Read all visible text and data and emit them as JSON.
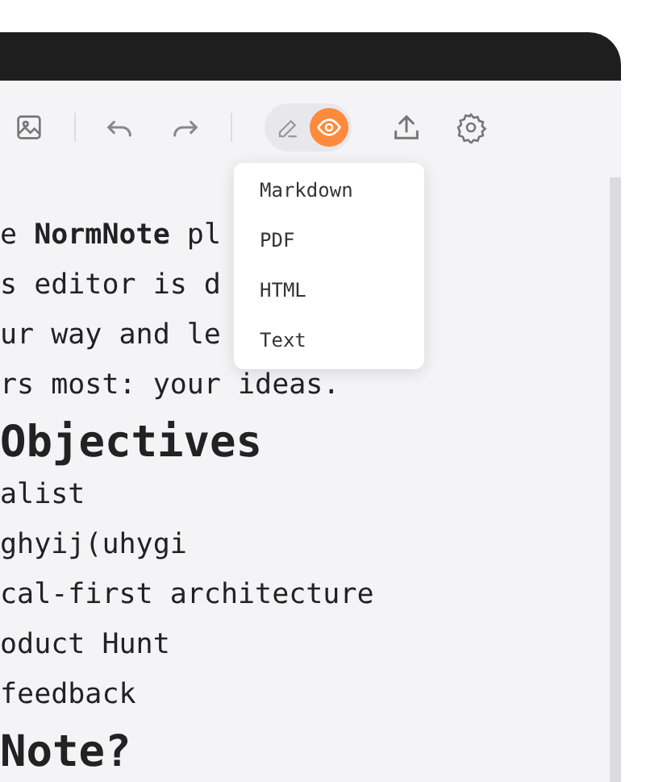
{
  "toolbar": {
    "modes": [
      {
        "kind": "edit",
        "selected": false
      },
      {
        "kind": "preview",
        "selected": true
      }
    ]
  },
  "export_menu": {
    "items": [
      "Markdown",
      "PDF",
      "HTML",
      "Text"
    ]
  },
  "document": {
    "lines": [
      {
        "kind": "p",
        "text": "e **NormNote** pl"
      },
      {
        "kind": "p",
        "text": "s editor is d"
      },
      {
        "kind": "p",
        "text": "ur way and le"
      },
      {
        "kind": "p",
        "text": "rs most: your ideas."
      },
      {
        "kind": "h",
        "text": "Objectives"
      },
      {
        "kind": "p",
        "text": "alist"
      },
      {
        "kind": "p",
        "text": "ghyij(uhygi"
      },
      {
        "kind": "p",
        "text": "cal-first architecture"
      },
      {
        "kind": "p",
        "text": "oduct Hunt"
      },
      {
        "kind": "p",
        "text": "feedback"
      },
      {
        "kind": "h",
        "text": "Note?"
      }
    ]
  }
}
